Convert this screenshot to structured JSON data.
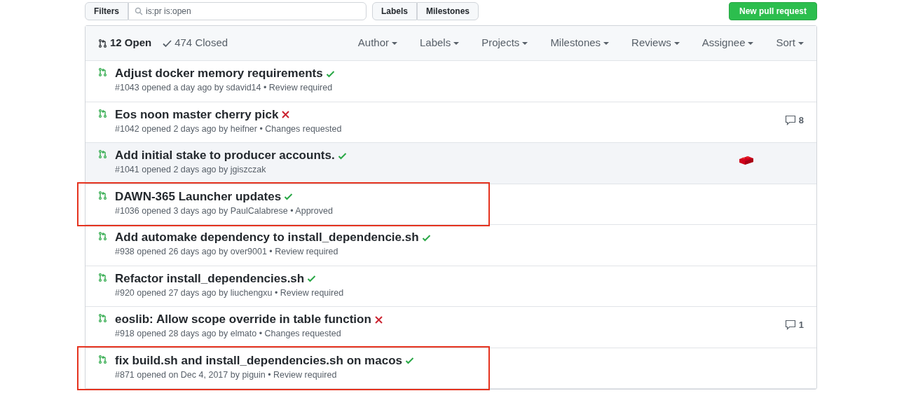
{
  "toolbar": {
    "filters_label": "Filters",
    "search_value": "is:pr is:open",
    "links": [
      "Labels",
      "Milestones"
    ],
    "new_button": "New pull request"
  },
  "states": [
    {
      "label": "12 Open",
      "selected": true
    },
    {
      "label": "474 Closed",
      "selected": false
    }
  ],
  "filters": [
    "Author",
    "Labels",
    "Projects",
    "Milestones",
    "Reviews",
    "Assignee",
    "Sort"
  ],
  "pulls": [
    {
      "title": "Adjust docker memory requirements",
      "checks_passed": true,
      "meta": "#1043 opened a day ago by sdavid14 • Review required",
      "hovered": false,
      "highlighted": false,
      "has_brick_icon": false
    },
    {
      "title": "Eos noon master cherry pick",
      "checks_passed": false,
      "meta": "#1042 opened 2 days ago by heifner • Changes requested",
      "comments": "8",
      "hovered": false,
      "highlighted": false,
      "has_brick_icon": false
    },
    {
      "title": "Add initial stake to producer accounts.",
      "checks_passed": true,
      "meta": "#1041 opened 2 days ago by jgiszczak",
      "hovered": true,
      "highlighted": false,
      "has_brick_icon": true
    },
    {
      "title": "DAWN-365 Launcher updates",
      "checks_passed": true,
      "meta": "#1036 opened 3 days ago by PaulCalabrese • Approved",
      "hovered": false,
      "highlighted": true,
      "has_brick_icon": false
    },
    {
      "title": "Add automake dependency to install_dependencie.sh",
      "checks_passed": true,
      "meta": "#938 opened 26 days ago by over9001 • Review required",
      "hovered": false,
      "highlighted": false,
      "has_brick_icon": false
    },
    {
      "title": "Refactor install_dependencies.sh",
      "checks_passed": true,
      "meta": "#920 opened 27 days ago by liuchengxu • Review required",
      "hovered": false,
      "highlighted": false,
      "has_brick_icon": false
    },
    {
      "title": "eoslib: Allow scope override in table function",
      "checks_passed": false,
      "meta": "#918 opened 28 days ago by elmato • Changes requested",
      "comments": "1",
      "hovered": false,
      "highlighted": false,
      "has_brick_icon": false
    },
    {
      "title": "fix build.sh and install_dependencies.sh on macos",
      "checks_passed": true,
      "meta": "#871 opened on Dec 4, 2017 by piguin • Review required",
      "hovered": false,
      "highlighted": true,
      "has_brick_icon": false
    }
  ]
}
